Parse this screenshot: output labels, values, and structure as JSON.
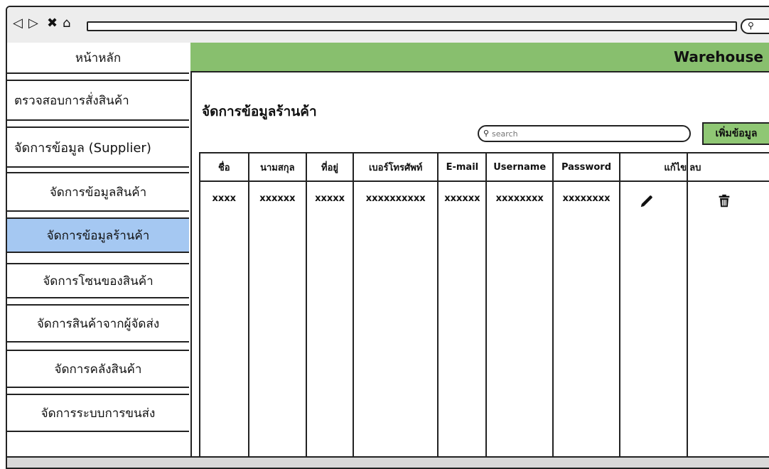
{
  "browser": {
    "nav_icons": [
      "back-icon",
      "forward-icon",
      "close-icon",
      "home-icon"
    ]
  },
  "sidebar": {
    "home": "หน้าหลัก",
    "items": [
      {
        "label": "ตรวจสอบการสั่งสินค้า"
      },
      {
        "label": "จัดการข้อมูล (Supplier)"
      },
      {
        "label": "จัดการข้อมูลสินค้า"
      },
      {
        "label": "จัดการข้อมูลร้านค้า",
        "active": true
      },
      {
        "label": "จัดการโซนของสินค้า"
      },
      {
        "label": "จัดการสินค้าจากผู้จัดส่ง"
      },
      {
        "label": "จัดการคลังสินค้า"
      },
      {
        "label": "จัดการระบบการขนส่ง"
      }
    ]
  },
  "header": {
    "brand": "Warehouse"
  },
  "main": {
    "title": "จัดการข้อมูลร้านค้า",
    "search_placeholder": "search",
    "add_button": "เพิ่มข้อมูล"
  },
  "table": {
    "columns": [
      "ชื่อ",
      "นามสกุล",
      "ที่อยู่",
      "เบอร์โทรศัพท์",
      "E-mail",
      "Username",
      "Password",
      "แก้ไข",
      "ลบ"
    ],
    "row": [
      "xxxx",
      "xxxxxx",
      "xxxxx",
      "xxxxxxxxxx",
      "xxxxxx",
      "xxxxxxxx",
      "xxxxxxxx"
    ]
  },
  "colors": {
    "topbar": "#88bf6e",
    "active_item": "#a5c8f2",
    "add_button": "#8fc774"
  }
}
